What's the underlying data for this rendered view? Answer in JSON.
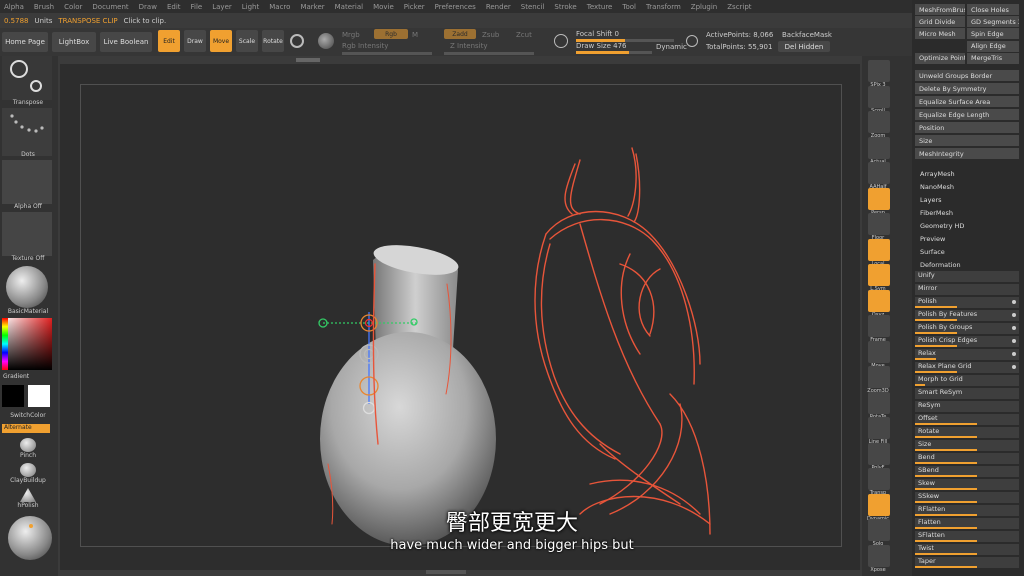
{
  "menu": [
    "Alpha",
    "Brush",
    "Color",
    "Document",
    "Draw",
    "Edit",
    "File",
    "Layer",
    "Light",
    "Macro",
    "Marker",
    "Material",
    "Movie",
    "Picker",
    "Preferences",
    "Render",
    "Stencil",
    "Stroke",
    "Texture",
    "Tool",
    "Transform",
    "Zplugin",
    "Zscript"
  ],
  "status": {
    "value": "0.5788",
    "units": "Units",
    "mode": "TRANSPOSE CLIP",
    "hint": "Click to clip."
  },
  "top": {
    "home": "Home Page",
    "lightbox": "LightBox",
    "liveboolean": "Live Boolean",
    "edit": "Edit",
    "draw": "Draw",
    "move": "Move",
    "scale": "Scale",
    "rotate": "Rotate",
    "mrgb": "Mrgb",
    "rgb": "Rgb",
    "m": "M",
    "rgb_intensity": "Rgb Intensity",
    "zadd": "Zadd",
    "zsub": "Zsub",
    "zcut": "Zcut",
    "z_intensity": "Z Intensity",
    "focal": "Focal Shift",
    "focal_val": "0",
    "drawsize": "Draw Size",
    "drawsize_val": "476",
    "dynamic": "Dynamic",
    "active_points": "ActivePoints: 8,066",
    "total_points": "TotalPoints: 55,901",
    "backface": "BackfaceMask",
    "delhidden": "Del Hidden"
  },
  "left": {
    "transpose": "Transpose",
    "dots": "Dots",
    "alpha": "Alpha Off",
    "texture": "Texture Off",
    "material": "BasicMaterial",
    "gradient": "Gradient",
    "switchcolor": "SwitchColor",
    "alternate": "Alternate",
    "pinch": "Pinch",
    "claybuildup": "ClayBuildup",
    "hpolish": "hPolish"
  },
  "righttools": [
    "SPix 3",
    "Scroll",
    "Zoom",
    "Actual",
    "AAHalf",
    "Persp",
    "Floor",
    "Local",
    "L.Sym",
    "Qxyz",
    "Frame",
    "Move",
    "Zoom3D",
    "RotaTe",
    "Line Fill",
    "PolyF",
    "Transp",
    "Dynamic",
    "Solo",
    "Xpose"
  ],
  "panel": {
    "top": [
      [
        "MeshFromBrush",
        "Close Holes"
      ],
      [
        "Grid Divide",
        "GD Segments 3"
      ],
      [
        "Micro Mesh",
        "Spin Edge"
      ],
      [
        "",
        "Align Edge"
      ],
      [
        "Optimize Points",
        "MergeTris"
      ]
    ],
    "wide": [
      "Unweld Groups Border",
      "Delete By Symmetry",
      "Equalize Surface Area",
      "Equalize Edge Length",
      "Position",
      "Size",
      "MeshIntegrity"
    ],
    "sub": [
      "ArrayMesh",
      "NanoMesh",
      "Layers",
      "FiberMesh",
      "Geometry HD",
      "Preview",
      "Surface",
      "Deformation"
    ],
    "deform": [
      "Unify",
      "Mirror",
      "Polish",
      "Polish By Features",
      "Polish By Groups",
      "Polish Crisp Edges",
      "Relax",
      "Relax Plane Grid",
      "Morph to Grid",
      "Smart ReSym",
      "ReSym",
      "Offset",
      "Rotate",
      "Size",
      "Bend",
      "SBend",
      "Skew",
      "SSkew",
      "RFlatten",
      "Flatten",
      "SFlatten",
      "Twist",
      "Taper"
    ]
  },
  "subtitles": {
    "cn": "臀部更宽更大",
    "en": "have much wider and bigger hips but"
  },
  "colors": {
    "accent": "#f0a030",
    "sketch": "#e8553a"
  }
}
